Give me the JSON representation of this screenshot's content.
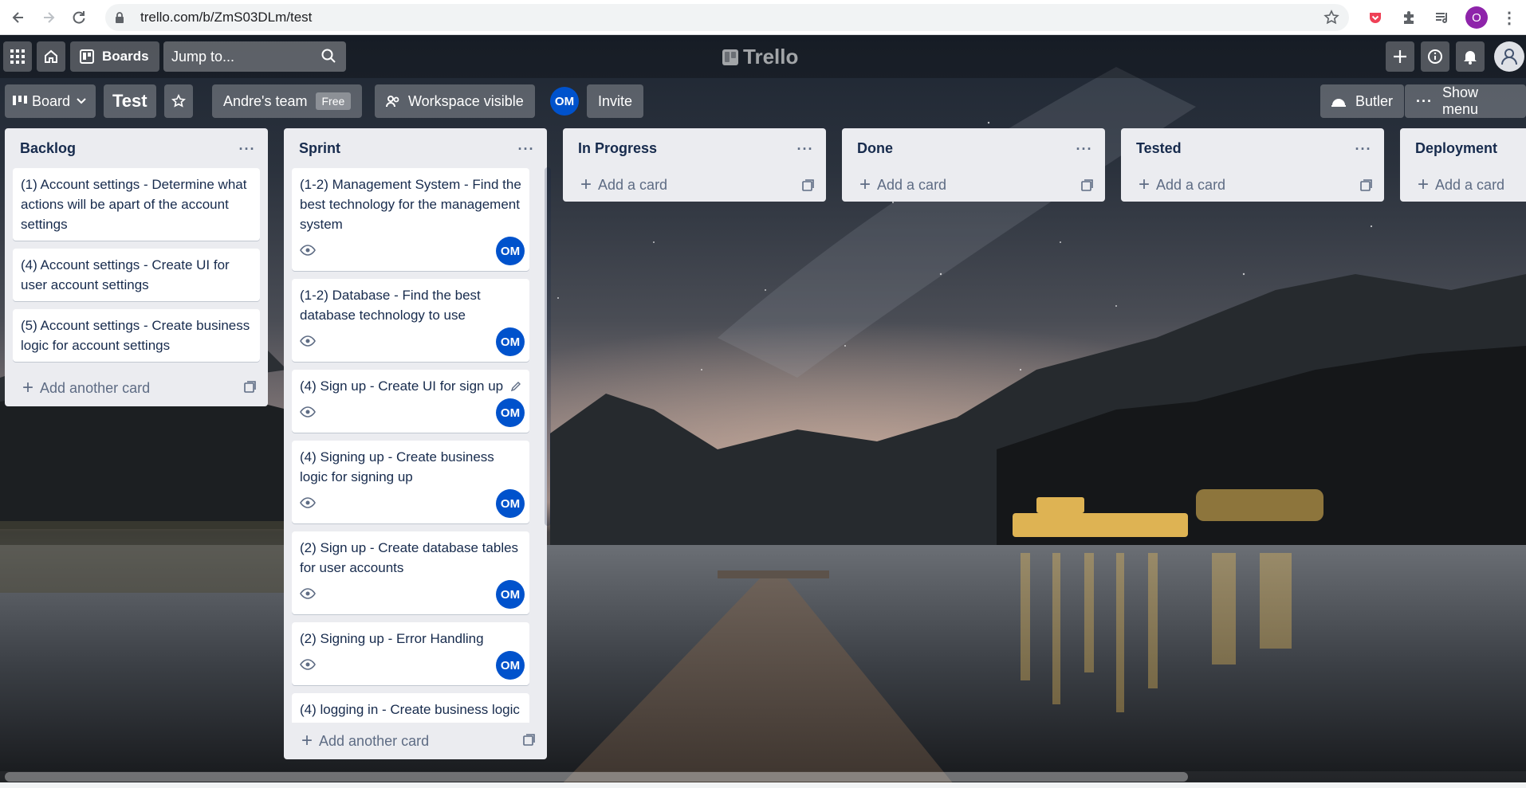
{
  "browser": {
    "url": "trello.com/b/ZmS03DLm/test",
    "profile_initial": "O"
  },
  "header": {
    "boards_label": "Boards",
    "search_placeholder": "Jump to...",
    "logo_text": "Trello"
  },
  "board": {
    "view_label": "Board",
    "title": "Test",
    "team_name": "Andre's team",
    "team_badge": "Free",
    "visibility_label": "Workspace visible",
    "member_initials": "OM",
    "invite_label": "Invite",
    "butler_label": "Butler",
    "show_menu_label": "Show menu"
  },
  "lists": [
    {
      "title": "Backlog",
      "add_label": "Add another card",
      "cards": [
        "(1) Account settings - Determine what actions will be apart of the account settings",
        "(4) Account settings - Create UI for user account settings",
        "(5) Account settings - Create business logic for account settings"
      ]
    },
    {
      "title": "Sprint",
      "add_label": "Add another card",
      "cards": [
        "(1-2) Management System - Find the best technology for the management system",
        "(1-2) Database - Find the best database technology to use",
        "(4) Sign up - Create UI for sign up",
        "(4) Signing up - Create business logic for signing up",
        "(2) Sign up - Create database tables for user accounts",
        "(2) Signing up - Error Handling",
        "(4) logging in - Create business logic"
      ]
    },
    {
      "title": "In Progress",
      "add_label": "Add a card"
    },
    {
      "title": "Done",
      "add_label": "Add a card"
    },
    {
      "title": "Tested",
      "add_label": "Add a card"
    },
    {
      "title": "Deployment",
      "add_label": "Add a card"
    }
  ],
  "colors": {
    "member_avatar": "#0052cc",
    "list_bg": "#ebecf0",
    "profile": "#8e24aa"
  }
}
